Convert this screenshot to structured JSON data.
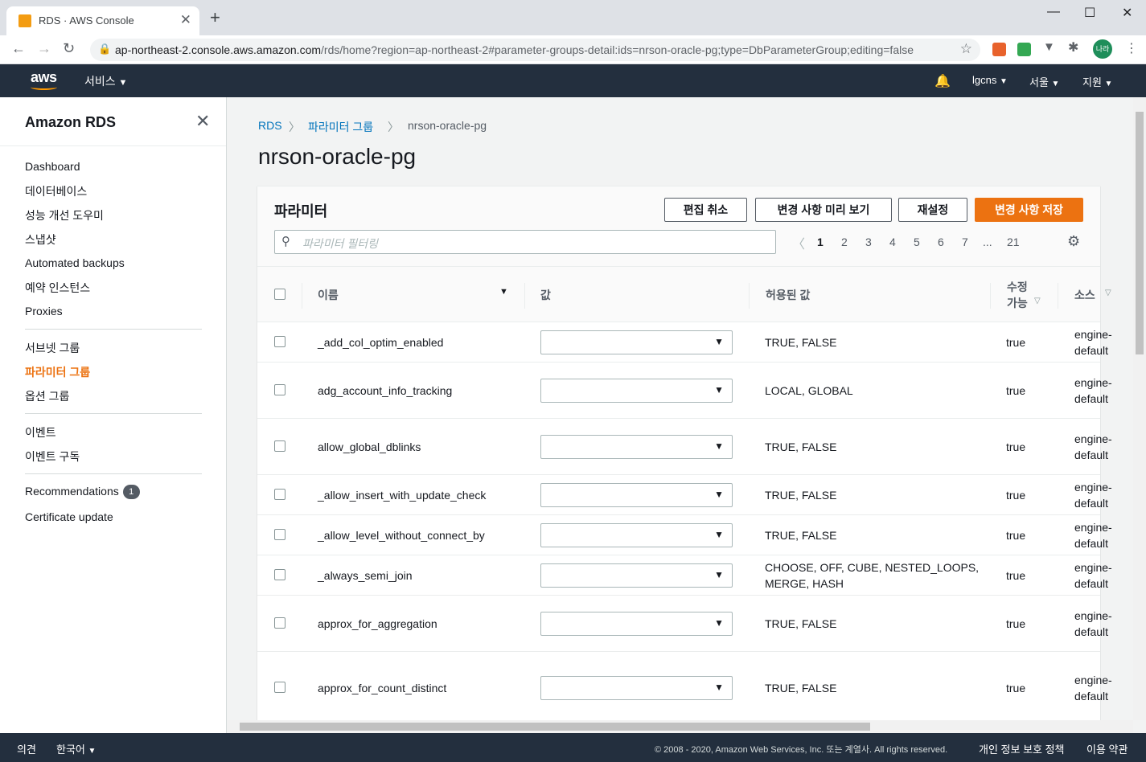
{
  "browser": {
    "tab_title": "RDS · AWS Console",
    "url_host": "ap-northeast-2.console.aws.amazon.com",
    "url_rest": "/rds/home?region=ap-northeast-2#parameter-groups-detail:ids=nrson-oracle-pg;type=DbParameterGroup;editing=false",
    "profile": "나라"
  },
  "awsnav": {
    "logo": "aws",
    "services": "서비스",
    "account": "lgcns",
    "region": "서울",
    "support": "지원"
  },
  "sidebar": {
    "title": "Amazon RDS",
    "group1": [
      "Dashboard",
      "데이터베이스",
      "성능 개선 도우미",
      "스냅샷",
      "Automated backups",
      "예약 인스턴스",
      "Proxies"
    ],
    "group2": [
      "서브넷 그룹",
      "파라미터 그룹",
      "옵션 그룹"
    ],
    "group3": [
      "이벤트",
      "이벤트 구독"
    ],
    "recommendations": "Recommendations",
    "recommendations_count": "1",
    "certificate": "Certificate update"
  },
  "breadcrumb": [
    "RDS",
    "파라미터 그룹",
    "nrson-oracle-pg"
  ],
  "page_title": "nrson-oracle-pg",
  "panel": {
    "title": "파라미터",
    "buttons": {
      "cancel": "편집 취소",
      "preview": "변경 사항 미리 보기",
      "reset": "재설정",
      "save": "변경 사항 저장"
    },
    "filter_placeholder": "파라미터 필터링",
    "pages": [
      "1",
      "2",
      "3",
      "4",
      "5",
      "6",
      "7",
      "...",
      "21"
    ],
    "current_page": "1"
  },
  "columns": {
    "name": "이름",
    "value": "값",
    "allowed": "허용된 값",
    "modifiable_1": "수정",
    "modifiable_2": "가능",
    "source": "소스"
  },
  "rows": [
    {
      "name": "_add_col_optim_enabled",
      "allowed": [
        "TRUE, FALSE"
      ],
      "modifiable": "true",
      "source": [
        "engine-",
        "default"
      ]
    },
    {
      "name": "adg_account_info_tracking",
      "allowed": [
        "LOCAL, GLOBAL"
      ],
      "modifiable": "true",
      "source": [
        "engine-",
        "default"
      ]
    },
    {
      "name": "allow_global_dblinks",
      "allowed": [
        "TRUE, FALSE"
      ],
      "modifiable": "true",
      "source": [
        "engine-",
        "default"
      ]
    },
    {
      "name": "_allow_insert_with_update_check",
      "allowed": [
        "TRUE, FALSE"
      ],
      "modifiable": "true",
      "source": [
        "engine-",
        "default"
      ]
    },
    {
      "name": "_allow_level_without_connect_by",
      "allowed": [
        "TRUE, FALSE"
      ],
      "modifiable": "true",
      "source": [
        "engine-",
        "default"
      ]
    },
    {
      "name": "_always_semi_join",
      "allowed": [
        "CHOOSE, OFF, CUBE, NESTED_LOOPS,",
        "MERGE, HASH"
      ],
      "modifiable": "true",
      "source": [
        "engine-",
        "default"
      ]
    },
    {
      "name": "approx_for_aggregation",
      "allowed": [
        "TRUE, FALSE"
      ],
      "modifiable": "true",
      "source": [
        "engine-",
        "default"
      ]
    },
    {
      "name": "approx_for_count_distinct",
      "allowed": [
        "TRUE, FALSE"
      ],
      "modifiable": "true",
      "source": [
        "engine-",
        "default"
      ]
    }
  ],
  "footer": {
    "feedback": "의견",
    "language": "한국어",
    "copyright": "© 2008 - 2020, Amazon Web Services, Inc. 또는 계열사. All rights reserved.",
    "privacy": "개인 정보 보호 정책",
    "terms": "이용 약관"
  }
}
